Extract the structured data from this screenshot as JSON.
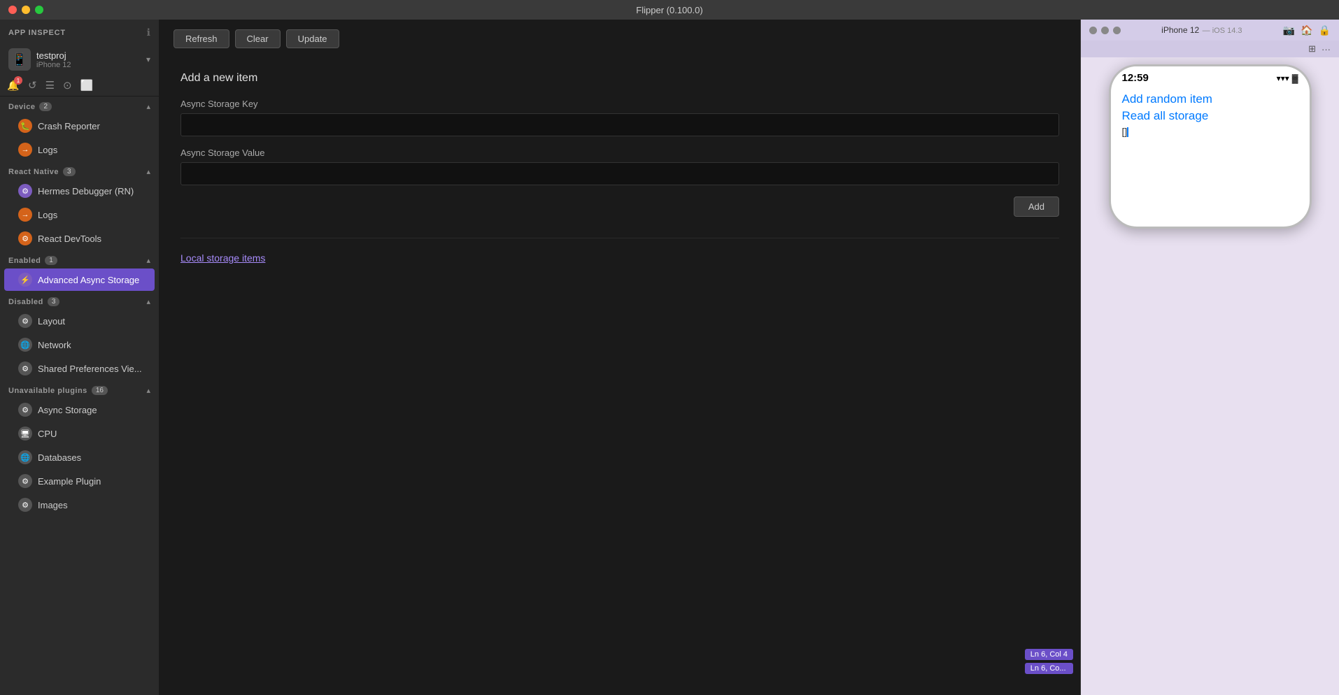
{
  "window": {
    "title": "Flipper (0.100.0)"
  },
  "sidebar": {
    "app_inspect_label": "APP INSPECT",
    "device": {
      "name": "testproj",
      "sub": "iPhone 12"
    },
    "sections": {
      "device": {
        "label": "Device",
        "count": "2",
        "items": [
          {
            "id": "crash-reporter",
            "label": "Crash Reporter",
            "icon": "🐛",
            "icon_class": "icon-orange"
          },
          {
            "id": "logs",
            "label": "Logs",
            "icon": "→",
            "icon_class": "icon-orange"
          }
        ]
      },
      "react_native": {
        "label": "React Native",
        "count": "3",
        "items": [
          {
            "id": "hermes-debugger",
            "label": "Hermes Debugger (RN)",
            "icon": "⚙",
            "icon_class": "icon-purple"
          },
          {
            "id": "logs-rn",
            "label": "Logs",
            "icon": "→",
            "icon_class": "icon-orange"
          },
          {
            "id": "react-devtools",
            "label": "React DevTools",
            "icon": "⚙",
            "icon_class": "icon-orange"
          }
        ]
      },
      "enabled": {
        "label": "Enabled",
        "count": "1",
        "items": [
          {
            "id": "advanced-async-storage",
            "label": "Advanced Async Storage",
            "icon": "⚡",
            "icon_class": "icon-purple",
            "active": true
          }
        ]
      },
      "disabled": {
        "label": "Disabled",
        "count": "3",
        "items": [
          {
            "id": "layout",
            "label": "Layout",
            "icon": "⚙",
            "icon_class": "icon-gray"
          },
          {
            "id": "network",
            "label": "Network",
            "icon": "🌐",
            "icon_class": "icon-gray"
          },
          {
            "id": "shared-prefs",
            "label": "Shared Preferences Vie...",
            "icon": "⚙",
            "icon_class": "icon-gray"
          }
        ]
      },
      "unavailable": {
        "label": "Unavailable plugins",
        "count": "16",
        "items": [
          {
            "id": "async-storage",
            "label": "Async Storage",
            "icon": "⚙",
            "icon_class": "icon-gray"
          },
          {
            "id": "cpu",
            "label": "CPU",
            "icon": "🖥",
            "icon_class": "icon-gray"
          },
          {
            "id": "databases",
            "label": "Databases",
            "icon": "🌐",
            "icon_class": "icon-gray"
          },
          {
            "id": "example-plugin",
            "label": "Example Plugin",
            "icon": "⚙",
            "icon_class": "icon-gray"
          },
          {
            "id": "images",
            "label": "Images",
            "icon": "⚙",
            "icon_class": "icon-gray"
          }
        ]
      }
    }
  },
  "toolbar": {
    "refresh_label": "Refresh",
    "clear_label": "Clear",
    "update_label": "Update"
  },
  "main": {
    "add_item_title": "Add a new item",
    "key_label": "Async Storage Key",
    "key_placeholder": "",
    "value_label": "Async Storage Value",
    "value_placeholder": "",
    "add_btn_label": "Add",
    "local_storage_title": "Local storage items"
  },
  "simulator": {
    "window_title": "iPhone 12",
    "window_sub": "iOS 14.3",
    "time": "12:59",
    "links": [
      "Add random item",
      "Read all storage"
    ],
    "cursor_text": "[]"
  },
  "status_badges": [
    "Ln 6, Col 4",
    "Ln 6, Co..."
  ]
}
